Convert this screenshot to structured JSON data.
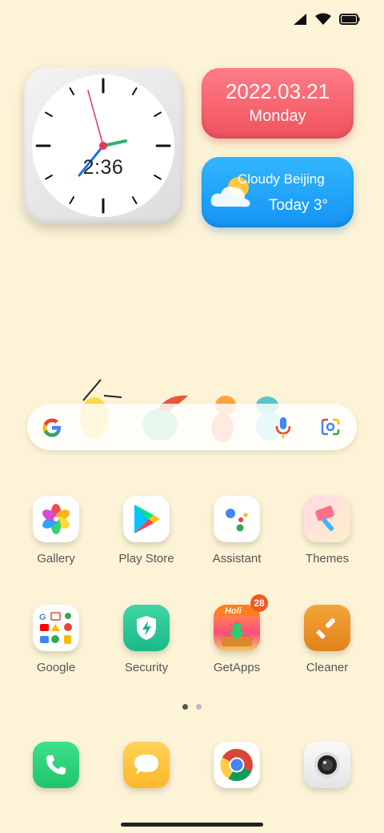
{
  "status_bar": {
    "icons": [
      "signal-icon",
      "wifi-icon",
      "battery-icon"
    ]
  },
  "clock_widget": {
    "time": "2:36"
  },
  "date_widget": {
    "date": "2022.03.21",
    "weekday": "Monday"
  },
  "weather_widget": {
    "condition": "Cloudy  Beijing",
    "temperature": "Today 3°"
  },
  "search_bar": {
    "icons": [
      "google-icon",
      "microphone-icon",
      "google-lens-icon"
    ]
  },
  "apps": [
    {
      "label": "Gallery"
    },
    {
      "label": "Play Store"
    },
    {
      "label": "Assistant"
    },
    {
      "label": "Themes"
    },
    {
      "label": "Google"
    },
    {
      "label": "Security"
    },
    {
      "label": "GetApps",
      "badge": "28",
      "icon_text": "Holi"
    },
    {
      "label": "Cleaner"
    }
  ],
  "dock": [
    {
      "icon": "phone-icon"
    },
    {
      "icon": "messages-icon"
    },
    {
      "icon": "chrome-icon"
    },
    {
      "icon": "camera-icon"
    }
  ],
  "page_indicator": {
    "pages": 2,
    "active": 1
  }
}
